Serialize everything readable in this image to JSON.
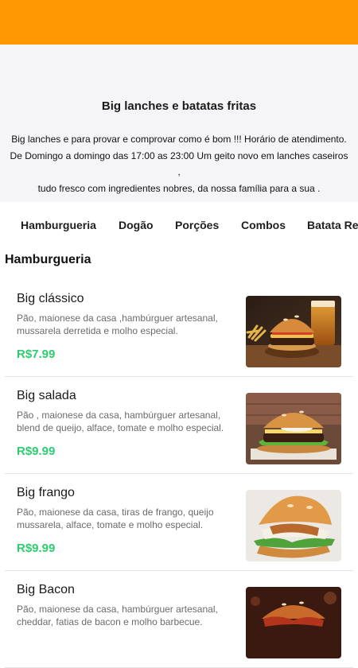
{
  "colors": {
    "accent": "#ff9800",
    "price": "#2ecc71"
  },
  "store": {
    "title": "Big lanches e batatas fritas",
    "description_lines": [
      "Big lanches e para provar e comprovar como é bom !!! Horário de atendimento.",
      "De Domingo a domingo das 17:00 as 23:00 Um geito novo em lanches caseiros ,",
      "tudo fresco com ingredientes nobres, da nossa família para a sua ."
    ]
  },
  "tabs": [
    {
      "label": "Hamburgueria"
    },
    {
      "label": "Dogão"
    },
    {
      "label": "Porções"
    },
    {
      "label": "Combos"
    },
    {
      "label": "Batata Recheada"
    }
  ],
  "section": {
    "title": "Hamburgueria"
  },
  "items": [
    {
      "name": "Big clássico",
      "desc_lines": [
        "Pão, maionese da casa ,hambúrguer artesanal,",
        "mussarela derretida e molho especial."
      ],
      "price": "R$7.99",
      "image": "burger-fries-beer-photo"
    },
    {
      "name": "Big salada",
      "desc_lines": [
        "Pão , maionese da casa, hambúrguer artesanal,",
        "blend de queijo, alface, tomate e molho especial."
      ],
      "price": "R$9.99",
      "image": "burger-salad-photo"
    },
    {
      "name": "Big frango",
      "desc_lines": [
        "Pão, maionese da casa, tiras de frango, queijo",
        "mussarela, alface, tomate e molho especial."
      ],
      "price": "R$9.99",
      "image": "chicken-burger-photo"
    },
    {
      "name": "Big Bacon",
      "desc_lines": [
        "Pão, maionese da casa, hambúrguer artesanal,",
        "cheddar, fatias de bacon e molho barbecue."
      ],
      "price": "",
      "image": "bacon-burger-photo"
    }
  ]
}
